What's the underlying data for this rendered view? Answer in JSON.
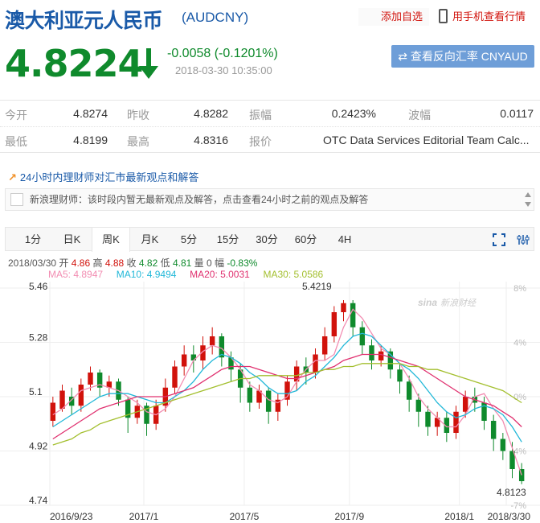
{
  "header": {
    "title": "澳大利亚元人民币",
    "code": "(AUDCNY)",
    "add_favorite": "添加自选",
    "mobile_view": "用手机查看行情"
  },
  "quote": {
    "price": "4.8224",
    "change": "-0.0058 (-0.1201%)",
    "timestamp": "2018-03-30 10:35:00",
    "reverse_button": "查看反向汇率 CNYAUD"
  },
  "stats": {
    "open_label": "今开",
    "open": "4.8274",
    "prev_close_label": "昨收",
    "prev_close": "4.8282",
    "amplitude_label": "振幅",
    "amplitude": "0.2423%",
    "volatility_label": "波幅",
    "volatility": "0.0117",
    "low_label": "最低",
    "low": "4.8199",
    "high_label": "最高",
    "high": "4.8316",
    "quote_source_label": "报价",
    "quote_source": "OTC Data Services Editorial Team Calc..."
  },
  "news": {
    "heading": "24小时内理财师对汇市最新观点和解答",
    "message": "新浪理财师：该时段内暂无最新观点及解答，点击查看24小时之前的观点及解答"
  },
  "tabs": [
    "1分",
    "日K",
    "周K",
    "月K",
    "5分",
    "15分",
    "30分",
    "60分",
    "4H"
  ],
  "active_tab": "周K",
  "chart_info": {
    "date": "2018/03/30",
    "open_label": "开",
    "open": "4.86",
    "high_label": "高",
    "high": "4.88",
    "close_label": "收",
    "close": "4.82",
    "low_label": "低",
    "low": "4.81",
    "volume_label": "量",
    "volume": "0",
    "range_label": "幅",
    "range": "-0.83%",
    "ma5": "MA5: 4.8947",
    "ma10": "MA10: 4.9494",
    "ma20": "MA20: 5.0031",
    "ma30": "MA30: 5.0586",
    "watermark": "新浪财经",
    "max_label": "5.4219",
    "min_label": "4.8123"
  },
  "colors": {
    "up": "#d1120b",
    "down": "#0f8a2c",
    "ma5": "#f28cb1",
    "ma10": "#22b8d8",
    "ma20": "#e0306f",
    "ma30": "#a3bf2e"
  },
  "chart_data": {
    "type": "candlestick",
    "y_ticks": [
      "5.46",
      "5.28",
      "5.1",
      "4.92",
      "4.74"
    ],
    "pct_ticks": [
      "8%",
      "4%",
      "0%",
      "-4%",
      "-7%"
    ],
    "x_ticks": [
      "2016/9/23",
      "2017/1",
      "2017/5",
      "2017/9",
      "2018/1",
      "2018/3/30"
    ],
    "ylim": [
      4.74,
      5.46
    ],
    "series": [
      {
        "name": "MA5",
        "values": [
          5.04,
          5.06,
          5.09,
          5.12,
          5.13,
          5.14,
          5.13,
          5.12,
          5.1,
          5.08,
          5.05,
          5.04,
          5.06,
          5.1,
          5.16,
          5.22,
          5.25,
          5.27,
          5.26,
          5.23,
          5.19,
          5.14,
          5.12,
          5.09,
          5.08,
          5.1,
          5.15,
          5.19,
          5.22,
          5.22,
          5.24,
          5.33,
          5.39,
          5.36,
          5.31,
          5.26,
          5.24,
          5.21,
          5.16,
          5.1,
          5.06,
          5.03,
          5.0,
          5.0,
          5.04,
          5.1,
          5.11,
          5.06,
          5.02,
          4.93,
          4.84
        ]
      },
      {
        "name": "MA10",
        "values": [
          5.0,
          5.02,
          5.04,
          5.06,
          5.08,
          5.1,
          5.11,
          5.11,
          5.11,
          5.1,
          5.09,
          5.08,
          5.08,
          5.1,
          5.12,
          5.15,
          5.19,
          5.22,
          5.24,
          5.23,
          5.21,
          5.18,
          5.16,
          5.13,
          5.11,
          5.11,
          5.12,
          5.15,
          5.17,
          5.2,
          5.23,
          5.27,
          5.3,
          5.31,
          5.3,
          5.27,
          5.24,
          5.21,
          5.19,
          5.16,
          5.12,
          5.08,
          5.05,
          5.03,
          5.04,
          5.06,
          5.07,
          5.06,
          5.04,
          5.0,
          4.95
        ]
      },
      {
        "name": "MA20",
        "values": [
          4.96,
          4.98,
          5.0,
          5.02,
          5.04,
          5.06,
          5.07,
          5.08,
          5.09,
          5.1,
          5.1,
          5.1,
          5.1,
          5.11,
          5.12,
          5.13,
          5.15,
          5.17,
          5.19,
          5.2,
          5.2,
          5.2,
          5.19,
          5.18,
          5.17,
          5.16,
          5.16,
          5.17,
          5.18,
          5.19,
          5.2,
          5.22,
          5.23,
          5.24,
          5.24,
          5.24,
          5.23,
          5.22,
          5.21,
          5.2,
          5.18,
          5.16,
          5.14,
          5.12,
          5.1,
          5.09,
          5.08,
          5.07,
          5.05,
          5.03,
          5.0
        ]
      },
      {
        "name": "MA30",
        "values": [
          4.94,
          4.95,
          4.96,
          4.98,
          4.99,
          5.01,
          5.02,
          5.03,
          5.04,
          5.05,
          5.06,
          5.07,
          5.08,
          5.09,
          5.1,
          5.11,
          5.12,
          5.13,
          5.14,
          5.15,
          5.16,
          5.16,
          5.17,
          5.17,
          5.17,
          5.17,
          5.17,
          5.18,
          5.18,
          5.19,
          5.19,
          5.2,
          5.2,
          5.21,
          5.21,
          5.21,
          5.21,
          5.21,
          5.2,
          5.2,
          5.19,
          5.19,
          5.18,
          5.17,
          5.16,
          5.15,
          5.14,
          5.13,
          5.12,
          5.1,
          5.08
        ]
      }
    ],
    "candles": [
      [
        5.02,
        5.08,
        5.0,
        5.1
      ],
      [
        5.06,
        5.12,
        5.05,
        5.14
      ],
      [
        5.1,
        5.07,
        5.04,
        5.13
      ],
      [
        5.07,
        5.14,
        5.05,
        5.16
      ],
      [
        5.14,
        5.18,
        5.12,
        5.2
      ],
      [
        5.18,
        5.13,
        5.1,
        5.19
      ],
      [
        5.13,
        5.15,
        5.1,
        5.17
      ],
      [
        5.15,
        5.09,
        5.07,
        5.16
      ],
      [
        5.09,
        5.03,
        4.98,
        5.1
      ],
      [
        5.03,
        5.07,
        5.01,
        5.09
      ],
      [
        5.07,
        5.01,
        4.97,
        5.08
      ],
      [
        5.01,
        5.07,
        4.99,
        5.09
      ],
      [
        5.07,
        5.13,
        5.05,
        5.16
      ],
      [
        5.13,
        5.2,
        5.11,
        5.22
      ],
      [
        5.2,
        5.24,
        5.17,
        5.27
      ],
      [
        5.24,
        5.22,
        5.18,
        5.27
      ],
      [
        5.22,
        5.27,
        5.19,
        5.3
      ],
      [
        5.27,
        5.3,
        5.24,
        5.33
      ],
      [
        5.3,
        5.23,
        5.2,
        5.31
      ],
      [
        5.23,
        5.19,
        5.15,
        5.25
      ],
      [
        5.19,
        5.13,
        5.08,
        5.21
      ],
      [
        5.13,
        5.08,
        5.05,
        5.15
      ],
      [
        5.08,
        5.12,
        5.06,
        5.14
      ],
      [
        5.12,
        5.05,
        5.01,
        5.13
      ],
      [
        5.05,
        5.09,
        5.02,
        5.11
      ],
      [
        5.09,
        5.15,
        5.07,
        5.17
      ],
      [
        5.15,
        5.2,
        5.12,
        5.22
      ],
      [
        5.2,
        5.18,
        5.14,
        5.23
      ],
      [
        5.18,
        5.24,
        5.16,
        5.26
      ],
      [
        5.24,
        5.3,
        5.22,
        5.33
      ],
      [
        5.3,
        5.38,
        5.28,
        5.4
      ],
      [
        5.38,
        5.41,
        5.35,
        5.42
      ],
      [
        5.41,
        5.33,
        5.3,
        5.42
      ],
      [
        5.33,
        5.27,
        5.24,
        5.35
      ],
      [
        5.27,
        5.22,
        5.19,
        5.29
      ],
      [
        5.22,
        5.25,
        5.2,
        5.27
      ],
      [
        5.25,
        5.19,
        5.16,
        5.26
      ],
      [
        5.19,
        5.15,
        5.11,
        5.21
      ],
      [
        5.15,
        5.09,
        5.05,
        5.17
      ],
      [
        5.09,
        5.05,
        5.0,
        5.11
      ],
      [
        5.05,
        5.0,
        4.97,
        5.07
      ],
      [
        5.0,
        5.03,
        4.97,
        5.05
      ],
      [
        5.03,
        4.98,
        4.95,
        5.05
      ],
      [
        4.98,
        5.05,
        4.96,
        5.07
      ],
      [
        5.05,
        5.1,
        5.03,
        5.12
      ],
      [
        5.1,
        5.08,
        5.05,
        5.13
      ],
      [
        5.08,
        5.02,
        4.99,
        5.1
      ],
      [
        5.02,
        4.96,
        4.92,
        5.04
      ],
      [
        4.96,
        4.92,
        4.89,
        4.98
      ],
      [
        4.92,
        4.86,
        4.83,
        4.95
      ],
      [
        4.86,
        4.82,
        4.81,
        4.88
      ]
    ]
  }
}
